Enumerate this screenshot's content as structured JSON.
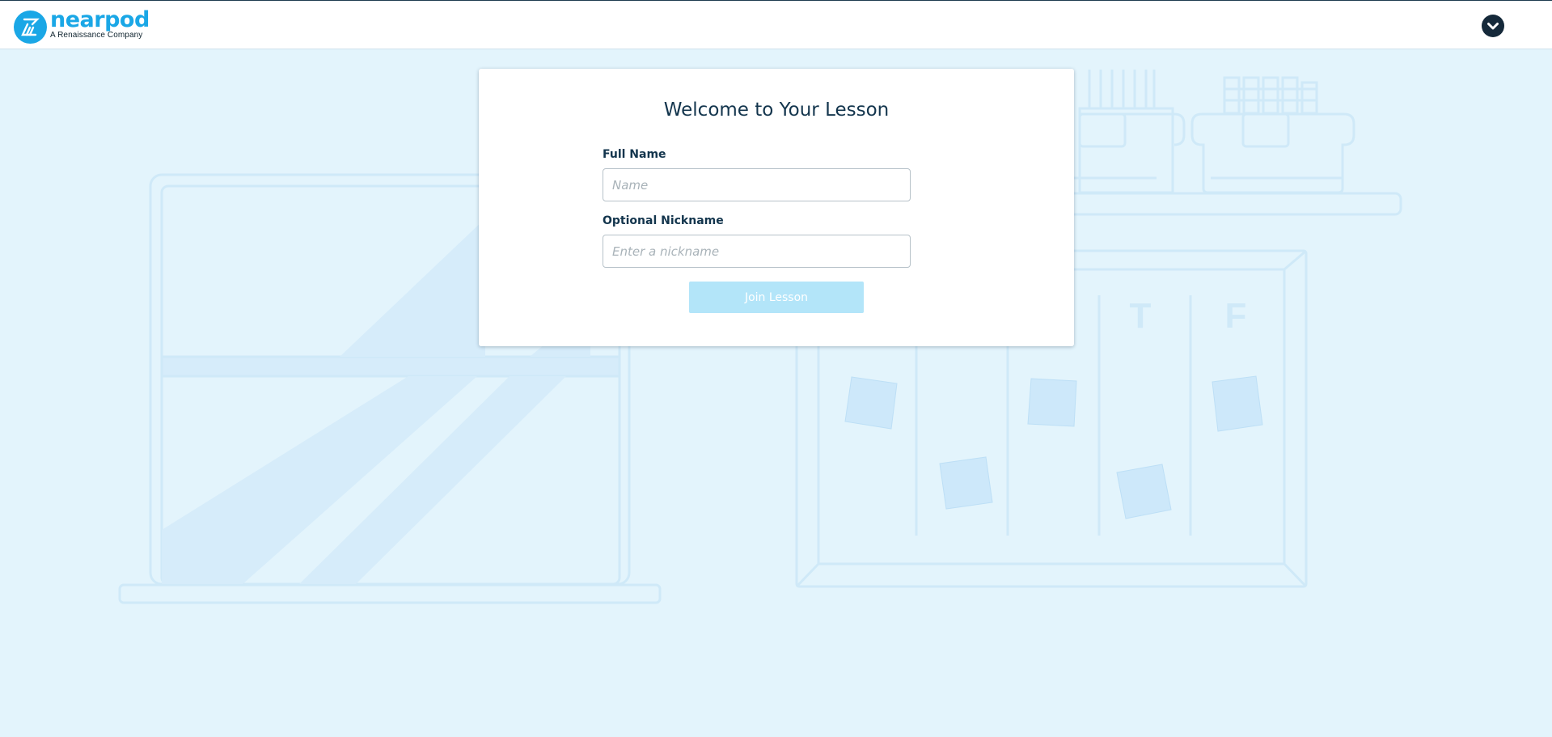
{
  "header": {
    "logo_text": "nearpod",
    "logo_subtext": "A Renaissance Company",
    "menu_icon": "chevron-down-icon"
  },
  "form": {
    "title": "Welcome to Your Lesson",
    "full_name_label": "Full Name",
    "full_name_placeholder": "Name",
    "full_name_value": "",
    "nickname_label": "Optional Nickname",
    "nickname_placeholder": "Enter a nickname",
    "nickname_value": "",
    "join_button_label": "Join Lesson",
    "join_button_state": "disabled"
  },
  "background": {
    "calendar_day_labels": [
      "T",
      "F"
    ]
  },
  "colors": {
    "brand": "#1aa7e6",
    "page_background": "#e3f4fc",
    "title_text": "#13354d",
    "join_button_disabled": "#b3e5f9"
  }
}
